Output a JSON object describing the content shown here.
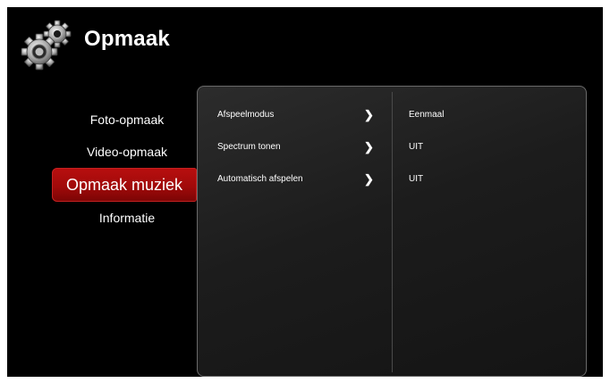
{
  "header": {
    "title": "Opmaak",
    "icon": "gear-icon"
  },
  "menu": {
    "items": [
      {
        "label": "Foto-opmaak",
        "active": false
      },
      {
        "label": "Video-opmaak",
        "active": false
      },
      {
        "label": "Opmaak muziek",
        "active": true
      },
      {
        "label": "Informatie",
        "active": false
      }
    ]
  },
  "settings": {
    "rows": [
      {
        "label": "Afspeelmodus",
        "value": "Eenmaal",
        "icon": "chevron-right-icon"
      },
      {
        "label": "Spectrum tonen",
        "value": "UIT",
        "icon": "chevron-right-icon"
      },
      {
        "label": "Automatisch afspelen",
        "value": "UIT",
        "icon": "chevron-right-icon"
      }
    ]
  },
  "colors": {
    "background": "#000000",
    "active_item": "#a10a0a",
    "panel_border": "#6a6a6a",
    "text": "#ffffff"
  }
}
